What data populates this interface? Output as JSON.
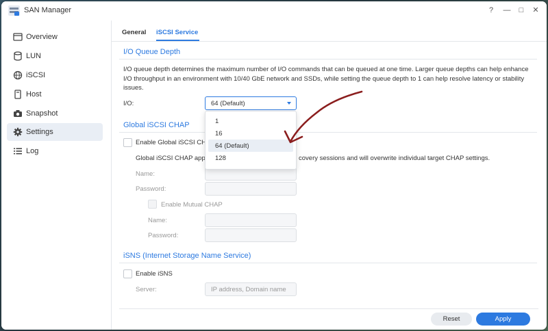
{
  "window": {
    "title": "SAN Manager"
  },
  "controls": {
    "help": "?",
    "minimize": "—",
    "maximize": "□",
    "close": "✕"
  },
  "sidebar": {
    "items": [
      {
        "label": "Overview",
        "icon": "overview-icon"
      },
      {
        "label": "LUN",
        "icon": "lun-icon"
      },
      {
        "label": "iSCSI",
        "icon": "iscsi-icon"
      },
      {
        "label": "Host",
        "icon": "host-icon"
      },
      {
        "label": "Snapshot",
        "icon": "camera-icon"
      },
      {
        "label": "Settings",
        "icon": "gear-icon",
        "active": true
      },
      {
        "label": "Log",
        "icon": "log-icon"
      }
    ]
  },
  "tabs": [
    {
      "label": "General"
    },
    {
      "label": "iSCSI Service",
      "active": true
    }
  ],
  "io_queue": {
    "title": "I/O Queue Depth",
    "description": "I/O queue depth determines the maximum number of I/O commands that can be queued at one time. Larger queue depths can help enhance I/O throughput in an environment with 10/40 GbE network and SSDs, while setting the queue depth to 1 can help resolve latency or stability issues.",
    "io_label": "I/O:",
    "selected": "64 (Default)",
    "options": [
      "1",
      "16",
      "64 (Default)",
      "128"
    ]
  },
  "chap": {
    "title": "Global iSCSI CHAP",
    "enable_label": "Enable Global iSCSI CH",
    "description_left": "Global iSCSI CHAP appl",
    "description_right": "covery sessions and will overwrite individual target CHAP settings.",
    "name_label": "Name:",
    "password_label": "Password:",
    "mutual_label": "Enable Mutual CHAP",
    "mutual_name_label": "Name:",
    "mutual_password_label": "Password:"
  },
  "isns": {
    "title": "iSNS (Internet Storage Name Service)",
    "enable_label": "Enable iSNS",
    "server_label": "Server:",
    "server_placeholder": "IP address, Domain name"
  },
  "footer": {
    "reset": "Reset",
    "apply": "Apply"
  },
  "colors": {
    "accent": "#2d7ae0",
    "annotation": "#8b1e1e"
  }
}
